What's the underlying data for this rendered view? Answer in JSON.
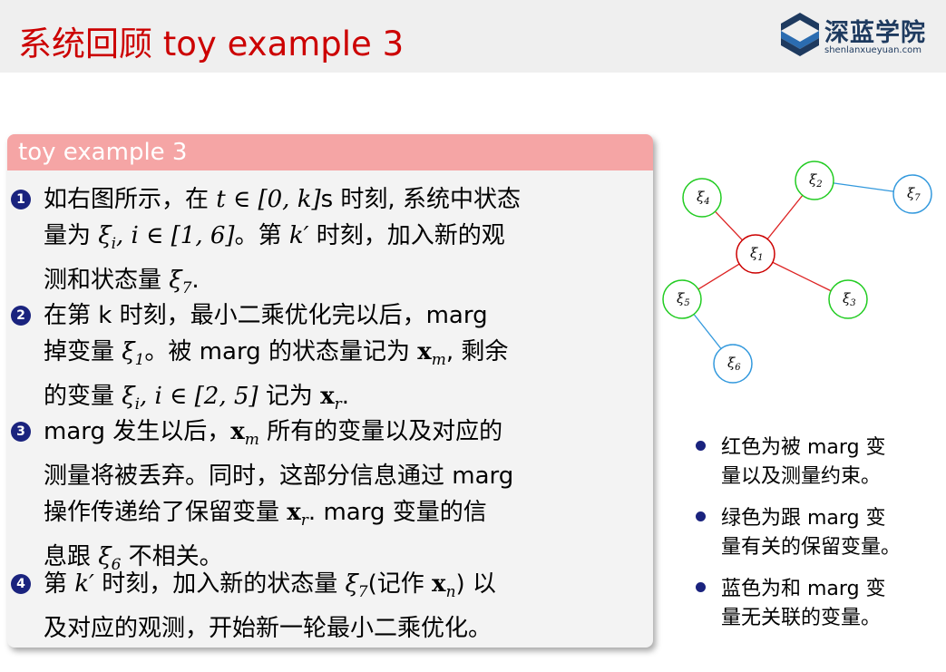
{
  "header": {
    "title": "系统回顾 toy example 3",
    "logo_text": "深蓝学院",
    "logo_url": "shenlanxueyuan.com",
    "title_color": "#cc0000"
  },
  "block": {
    "title": "toy example 3",
    "items": [
      {
        "number": "1",
        "lines": [
          [
            "如右图所示，在 ",
            {
              "m": "t ∈ [0, k]"
            },
            "s 时刻, 系统中状态"
          ],
          [
            "量为 ",
            {
              "m": "ξ"
            },
            {
              "sub": "i"
            },
            {
              "m": ", i ∈ [1, 6]"
            },
            "。第 ",
            {
              "m": "k′"
            },
            " 时刻，加入新的观"
          ],
          [
            "测和状态量 ",
            {
              "m": "ξ"
            },
            {
              "sub": "7"
            },
            "."
          ]
        ]
      },
      {
        "number": "2",
        "lines": [
          [
            "在第 k 时刻，最小二乘优化完以后，marg"
          ],
          [
            "掉变量 ",
            {
              "m": "ξ"
            },
            {
              "sub": "1"
            },
            "。被 marg 的状态量记为 ",
            {
              "b": "x"
            },
            {
              "sub": "m"
            },
            ", 剩余"
          ],
          [
            "的变量 ",
            {
              "m": "ξ"
            },
            {
              "sub": "i"
            },
            {
              "m": ", i ∈ [2, 5]"
            },
            " 记为 ",
            {
              "b": "x"
            },
            {
              "sub": "r"
            },
            "."
          ]
        ]
      },
      {
        "number": "3",
        "lines": [
          [
            "marg 发生以后，",
            {
              "b": "x"
            },
            {
              "sub": "m"
            },
            " 所有的变量以及对应的"
          ],
          [
            "测量将被丢弃。同时，这部分信息通过 marg"
          ],
          [
            "操作传递给了保留变量 ",
            {
              "b": "x"
            },
            {
              "sub": "r"
            },
            ". marg 变量的信"
          ],
          [
            "息跟 ",
            {
              "m": "ξ"
            },
            {
              "sub": "6"
            },
            " 不相关。"
          ]
        ]
      },
      {
        "number": "4",
        "lines": [
          [
            "第 ",
            {
              "m": "k′"
            },
            " 时刻，加入新的状态量 ",
            {
              "m": "ξ"
            },
            {
              "sub": "7"
            },
            "(记作 ",
            {
              "b": "x"
            },
            {
              "sub": "n"
            },
            ") 以"
          ],
          [
            "及对应的观测，开始新一轮最小二乘优化。"
          ]
        ]
      }
    ]
  },
  "graph": {
    "nodes": [
      {
        "label": "ξ",
        "sub": "1",
        "color": "#cc0000"
      },
      {
        "label": "ξ",
        "sub": "2",
        "color": "#22cc22"
      },
      {
        "label": "ξ",
        "sub": "3",
        "color": "#22cc22"
      },
      {
        "label": "ξ",
        "sub": "4",
        "color": "#22cc22"
      },
      {
        "label": "ξ",
        "sub": "5",
        "color": "#22cc22"
      },
      {
        "label": "ξ",
        "sub": "6",
        "color": "#3399dd"
      },
      {
        "label": "ξ",
        "sub": "7",
        "color": "#3399dd"
      }
    ],
    "edge_colors": {
      "marg": "#dd2222",
      "other": "#3399dd"
    }
  },
  "bullets": [
    [
      "红色为被 marg 变",
      "量以及测量约束。"
    ],
    [
      "绿色为跟 marg 变",
      "量有关的保留变量。"
    ],
    [
      "蓝色为和 marg 变",
      "量无关联的变量。"
    ]
  ]
}
